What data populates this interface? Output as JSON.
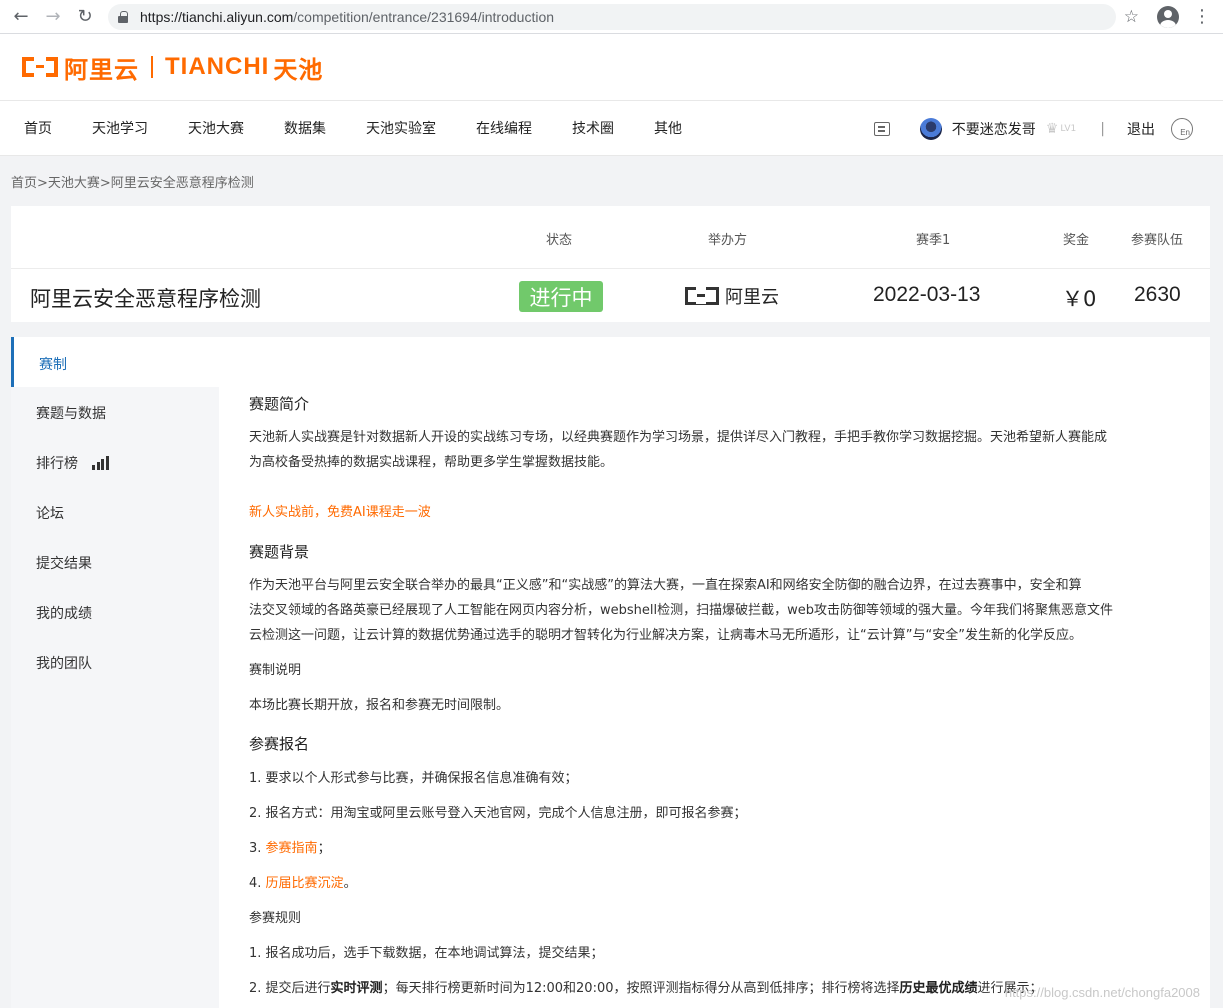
{
  "browser": {
    "url_host": "https://tianchi.aliyun.com",
    "url_path": "/competition/entrance/231694/introduction"
  },
  "logo": {
    "cn": "阿里云",
    "en": "TIANCHI",
    "cn2": "天池"
  },
  "nav": {
    "items": [
      "首页",
      "天池学习",
      "天池大赛",
      "数据集",
      "天池实验室",
      "在线编程",
      "技术圈",
      "其他"
    ],
    "username": "不要迷恋发哥",
    "level": "LV1",
    "separator": "|",
    "logout": "退出",
    "lang": "En"
  },
  "breadcrumb": "首页>天池大赛>阿里云安全恶意程序检测",
  "competition": {
    "headers": {
      "status": "状态",
      "organizer": "举办方",
      "season": "赛季1",
      "prize": "奖金",
      "teams": "参赛队伍"
    },
    "title": "阿里云安全恶意程序检测",
    "status": "进行中",
    "organizer": "阿里云",
    "season_date": "2022-03-13",
    "prize": "￥0",
    "teams": "2630"
  },
  "sidebar": {
    "active": "赛制",
    "items": [
      "赛题与数据",
      "排行榜",
      "论坛",
      "提交结果",
      "我的成绩",
      "我的团队"
    ]
  },
  "article": {
    "intro_title": "赛题简介",
    "intro_p1": "天池新人实战赛是针对数据新人开设的实战练习专场，以经典赛题作为学习场景，提供详尽入门教程，手把手教你学习数据挖掘。天池希望新人赛能成",
    "intro_p2": "为高校备受热捧的数据实战课程，帮助更多学生掌握数据技能。",
    "intro_link": "新人实战前，免费AI课程走一波",
    "bg_title": "赛题背景",
    "bg_p1": "作为天池平台与阿里云安全联合举办的最具“正义感”和“实战感”的算法大赛，一直在探索AI和网络安全防御的融合边界，在过去赛事中，安全和算",
    "bg_p2": "法交叉领域的各路英豪已经展现了人工智能在网页内容分析，webshell检测，扫描爆破拦截，web攻击防御等领域的强大量。今年我们将聚焦恶意文件",
    "bg_p3": "云检测这一问题，让云计算的数据优势通过选手的聪明才智转化为行业解决方案，让病毒木马无所遁形，让“云计算”与“安全”发生新的化学反应。",
    "rules_title": "赛制说明",
    "rules_p": "本场比赛长期开放，报名和参赛无时间限制。",
    "signup_title": "参赛报名",
    "signup_1": "1. 要求以个人形式参与比赛，并确保报名信息准确有效；",
    "signup_2": "2. 报名方式：用淘宝或阿里云账号登入天池官网，完成个人信息注册，即可报名参赛；",
    "signup_3_prefix": "3. ",
    "signup_3_link": "参赛指南",
    "signup_3_suffix": "；",
    "signup_4_prefix": "4. ",
    "signup_4_link": "历届比赛沉淀",
    "signup_4_suffix": "。",
    "prules_title": "参赛规则",
    "prules_1": "1. 报名成功后，选手下载数据，在本地调试算法，提交结果；",
    "prules_2_a": "2. 提交后进行",
    "prules_2_b": "实时评测",
    "prules_2_c": "；每天排行榜更新时间为12:00和20:00，按照评测指标得分从高到低排序；排行榜将选择",
    "prules_2_d": "历史最优成绩",
    "prules_2_e": "进行展示；"
  },
  "watermark": "https://blog.csdn.net/chongfa2008"
}
